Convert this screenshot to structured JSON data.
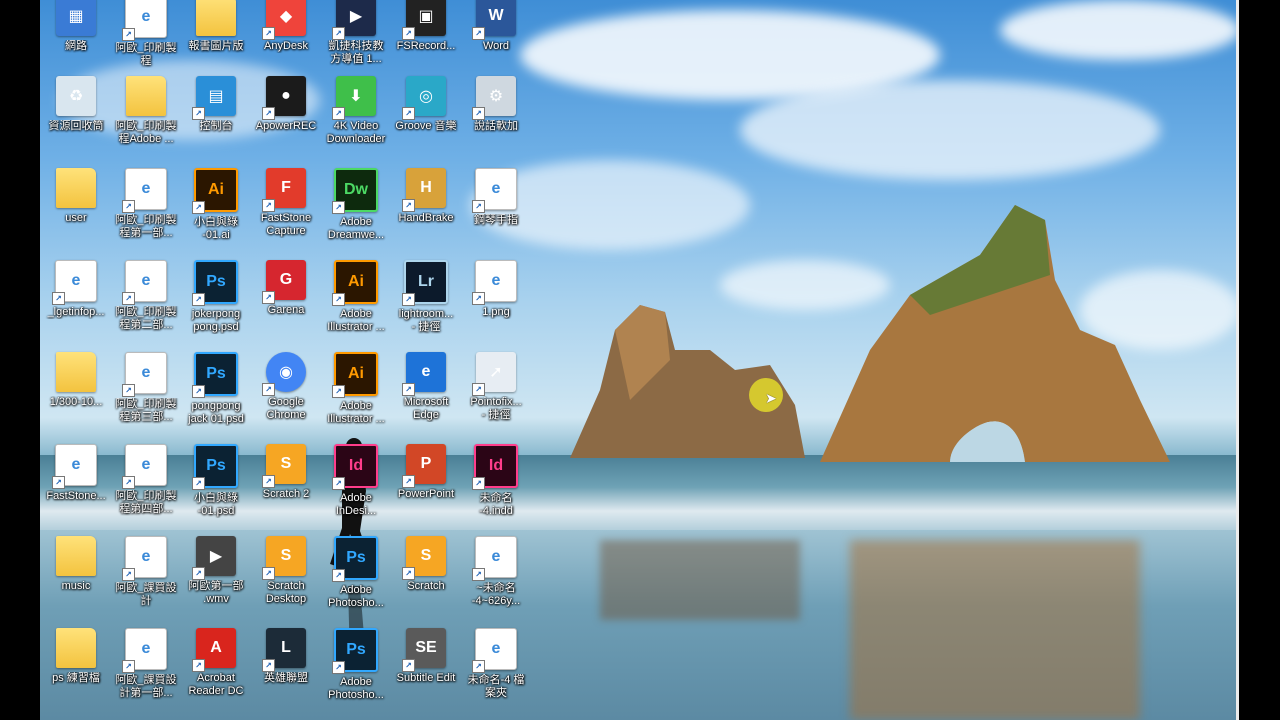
{
  "desktop": {
    "icons": [
      {
        "label": "網路",
        "type": "network",
        "col": 0,
        "row": 0,
        "color": "#3a7bd5"
      },
      {
        "label": "阿歐_印刷製\n程",
        "type": "doc",
        "col": 1,
        "row": 0,
        "color": "#ffffff"
      },
      {
        "label": "報書圖片版",
        "type": "folder",
        "col": 2,
        "row": 0,
        "color": "#f3c33f"
      },
      {
        "label": "AnyDesk",
        "type": "app",
        "col": 3,
        "row": 0,
        "color": "#ef443b"
      },
      {
        "label": "凱捷科技教\n方導值 1...",
        "type": "app",
        "col": 4,
        "row": 0,
        "color": "#1d2a4a"
      },
      {
        "label": "FSRecord...",
        "type": "app",
        "col": 5,
        "row": 0,
        "color": "#222222"
      },
      {
        "label": "Word",
        "type": "app",
        "col": 6,
        "row": 0,
        "color": "#2b579a"
      },
      {
        "label": "資源回收筒",
        "type": "recycle",
        "col": 0,
        "row": 1,
        "color": "#d9e6ef"
      },
      {
        "label": "阿歐_印刷製\n程Adobe ...",
        "type": "folder",
        "col": 1,
        "row": 1,
        "color": "#f3c33f"
      },
      {
        "label": "控制台",
        "type": "app",
        "col": 2,
        "row": 1,
        "color": "#2a8fd8"
      },
      {
        "label": "ApowerREC",
        "type": "app",
        "col": 3,
        "row": 1,
        "color": "#1b1b1b"
      },
      {
        "label": "4K Video\nDownloader",
        "type": "app",
        "col": 4,
        "row": 1,
        "color": "#3fbf4a"
      },
      {
        "label": "Groove 音樂",
        "type": "app",
        "col": 5,
        "row": 1,
        "color": "#2aa8c8"
      },
      {
        "label": "說話軟加",
        "type": "app",
        "col": 6,
        "row": 1,
        "color": "#cfd8e0"
      },
      {
        "label": "user",
        "type": "folder",
        "col": 0,
        "row": 2,
        "color": "#f3c33f"
      },
      {
        "label": "阿歐_印刷製\n程第一部...",
        "type": "doc",
        "col": 1,
        "row": 2,
        "color": "#ffffff"
      },
      {
        "label": "小白與綠\n-01.ai",
        "type": "ai",
        "col": 2,
        "row": 2,
        "color": "#ff9a00"
      },
      {
        "label": "FastStone\nCapture",
        "type": "app",
        "col": 3,
        "row": 2,
        "color": "#e23b2b"
      },
      {
        "label": "Adobe\nDreamwe...",
        "type": "dw",
        "col": 4,
        "row": 2,
        "color": "#4cd964"
      },
      {
        "label": "HandBrake",
        "type": "app",
        "col": 5,
        "row": 2,
        "color": "#d8a23a"
      },
      {
        "label": "鋼琴手指",
        "type": "doc",
        "col": 6,
        "row": 2,
        "color": "#ffffff"
      },
      {
        "label": "_lgetinfop...",
        "type": "doc",
        "col": 0,
        "row": 3,
        "color": "#ffffff"
      },
      {
        "label": "阿歐_印刷製\n程第二部...",
        "type": "doc",
        "col": 1,
        "row": 3,
        "color": "#ffffff"
      },
      {
        "label": "jokerpong\npong.psd",
        "type": "ps",
        "col": 2,
        "row": 3,
        "color": "#31a8ff"
      },
      {
        "label": "Garena",
        "type": "app",
        "col": 3,
        "row": 3,
        "color": "#d6262f"
      },
      {
        "label": "Adobe\nIllustrator ...",
        "type": "ai",
        "col": 4,
        "row": 3,
        "color": "#ff9a00"
      },
      {
        "label": "lightroom...\n- 捷徑",
        "type": "lr",
        "col": 5,
        "row": 3,
        "color": "#add5ec"
      },
      {
        "label": "1.png",
        "type": "doc",
        "col": 6,
        "row": 3,
        "color": "#ffffff"
      },
      {
        "label": "1/300-10...",
        "type": "folder",
        "col": 0,
        "row": 4,
        "color": "#f3c33f"
      },
      {
        "label": "阿歐_印刷製\n程第三部...",
        "type": "doc",
        "col": 1,
        "row": 4,
        "color": "#ffffff"
      },
      {
        "label": "pongpong\njack 01.psd",
        "type": "ps",
        "col": 2,
        "row": 4,
        "color": "#31a8ff"
      },
      {
        "label": "Google\nChrome",
        "type": "chrome",
        "col": 3,
        "row": 4,
        "color": "#4285f4"
      },
      {
        "label": "Adobe\nIllustrator ...",
        "type": "ai",
        "col": 4,
        "row": 4,
        "color": "#ff9a00"
      },
      {
        "label": "Microsoft\nEdge",
        "type": "app",
        "col": 5,
        "row": 4,
        "color": "#1e73d8"
      },
      {
        "label": "Pointofix...\n- 捷徑",
        "type": "app",
        "col": 6,
        "row": 4,
        "color": "#e7edf3"
      },
      {
        "label": "FastStone...",
        "type": "doc",
        "col": 0,
        "row": 5,
        "color": "#ffffff"
      },
      {
        "label": "阿歐_印刷製\n程第四部...",
        "type": "doc",
        "col": 1,
        "row": 5,
        "color": "#ffffff"
      },
      {
        "label": "小白與綠\n-01.psd",
        "type": "ps",
        "col": 2,
        "row": 5,
        "color": "#31a8ff"
      },
      {
        "label": "Scratch 2",
        "type": "app",
        "col": 3,
        "row": 5,
        "color": "#f6a623"
      },
      {
        "label": "Adobe\nInDesi...",
        "type": "id",
        "col": 4,
        "row": 5,
        "color": "#ff3d8b"
      },
      {
        "label": "PowerPoint",
        "type": "app",
        "col": 5,
        "row": 5,
        "color": "#d24726"
      },
      {
        "label": "未命名\n-4.indd",
        "type": "id",
        "col": 6,
        "row": 5,
        "color": "#ff3d8b"
      },
      {
        "label": "music",
        "type": "folder",
        "col": 0,
        "row": 6,
        "color": "#f3c33f"
      },
      {
        "label": "阿歐_課買設\n計",
        "type": "doc",
        "col": 1,
        "row": 6,
        "color": "#ffffff"
      },
      {
        "label": "阿歐第一部\n.wmv",
        "type": "video",
        "col": 2,
        "row": 6,
        "color": "#444444"
      },
      {
        "label": "Scratch\nDesktop",
        "type": "app",
        "col": 3,
        "row": 6,
        "color": "#f6a623"
      },
      {
        "label": "Adobe\nPhotosho...",
        "type": "ps",
        "col": 4,
        "row": 6,
        "color": "#31a8ff"
      },
      {
        "label": "Scratch",
        "type": "app",
        "col": 5,
        "row": 6,
        "color": "#f6a623"
      },
      {
        "label": "~未命名\n-4~626y...",
        "type": "doc",
        "col": 6,
        "row": 6,
        "color": "#ffffff"
      },
      {
        "label": "ps 練習檔",
        "type": "folder",
        "col": 0,
        "row": 7,
        "color": "#f3c33f"
      },
      {
        "label": "阿歐_課買設\n計第一部...",
        "type": "doc",
        "col": 1,
        "row": 7,
        "color": "#ffffff"
      },
      {
        "label": "Acrobat\nReader DC",
        "type": "app",
        "col": 2,
        "row": 7,
        "color": "#d9251d"
      },
      {
        "label": "英雄聯盟",
        "type": "app",
        "col": 3,
        "row": 7,
        "color": "#1c2b38"
      },
      {
        "label": "Adobe\nPhotosho...",
        "type": "ps",
        "col": 4,
        "row": 7,
        "color": "#31a8ff"
      },
      {
        "label": "Subtitle Edit",
        "type": "app",
        "col": 5,
        "row": 7,
        "color": "#5a5a5a"
      },
      {
        "label": "未命名-4 檔\n案夾",
        "type": "doc",
        "col": 6,
        "row": 7,
        "color": "#ffffff"
      }
    ]
  },
  "icon_glyphs": {
    "Word": "W",
    "AnyDesk": "◆",
    "ApowerREC": "●",
    "4K Video\nDownloader": "⬇",
    "Groove 音樂": "◎",
    "Garena": "G",
    "Google\nChrome": "◉",
    "Microsoft\nEdge": "e",
    "PowerPoint": "P",
    "Acrobat\nReader DC": "A",
    "Subtitle Edit": "SE",
    "英雄聯盟": "L",
    "Scratch 2": "S",
    "Scratch\nDesktop": "S",
    "Scratch": "S",
    "FastStone\nCapture": "F",
    "HandBrake": "H",
    "FSRecord...": "▣",
    "控制台": "▤",
    "說話軟加": "⚙",
    "資源回收筒": "♻",
    "網路": "▦",
    "凱捷科技教\n方導值 1...": "▶",
    "Pointofix...\n- 捷徑": "➚",
    "lightroom...\n- 捷徑": "Lr",
    "阿歐第一部\n.wmv": "▶"
  },
  "cursor": {
    "highlight_color": "#eee828"
  }
}
